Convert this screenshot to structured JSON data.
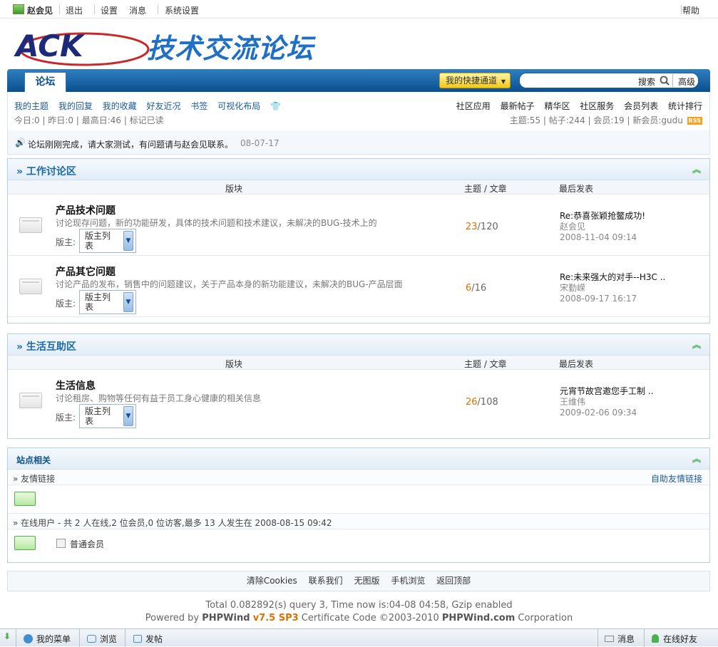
{
  "topbar": {
    "user": "赵会见",
    "logout": "退出",
    "settings": "设置",
    "messages": "消息",
    "system_settings": "系统设置",
    "help": "帮助"
  },
  "header": {
    "logo_text": "ACK",
    "site_title": "技术交流论坛"
  },
  "nav": {
    "tab": "论坛",
    "quick_label": "我的快捷通道",
    "search_label": "搜索",
    "advanced": "高级"
  },
  "subnav": {
    "links": [
      "我的主题",
      "我的回复",
      "我的收藏",
      "好友近况",
      "书签",
      "可视化布局"
    ],
    "right_links": [
      "社区应用",
      "最新帖子",
      "精华区",
      "社区服务",
      "会员列表",
      "统计排行"
    ],
    "stats_left": "今日:0 | 昨日:0 | 最高日:46 | 标记已读",
    "stats_right": "主题:55 | 帖子:244 | 会员:19 | 新会员:gudu",
    "rss": "RSS"
  },
  "notice": {
    "text": "论坛刚刚完成，请大家测试，有问题请与赵会见联系。",
    "date": "08-07-17"
  },
  "columns": {
    "forum": "版块",
    "counts": "主题 / 文章",
    "last": "最后发表"
  },
  "moderator_label": "版主:",
  "moderator_select": "版主列表",
  "sections": [
    {
      "title": "» 工作讨论区",
      "forums": [
        {
          "name": "产品技术问题",
          "desc": "讨论现存问题，新的功能研发，具体的技术问题和技术建议，未解决的BUG-技术上的",
          "topics": "23",
          "posts": "/120",
          "last_title": "Re:恭喜张颖抢鳖成功!",
          "last_author": "赵会见",
          "last_time": "2008-11-04 09:14"
        },
        {
          "name": "产品其它问题",
          "desc": "讨论产品的发布，销售中的问题建议，关于产品本身的新功能建议，未解决的BUG-产品层面",
          "topics": "6",
          "posts": "/16",
          "last_title": "Re:未来强大的对手--H3C ..",
          "last_author": "宋勤嵘",
          "last_time": "2008-09-17 16:17"
        }
      ]
    },
    {
      "title": "» 生活互助区",
      "forums": [
        {
          "name": "生活信息",
          "desc": "讨论租房、购物等任何有益于员工身心健康的相关信息",
          "topics": "26",
          "posts": "/108",
          "last_title": "元宵节故宫邀您手工制 ..",
          "last_author": "王维伟",
          "last_time": "2009-02-06 09:34"
        }
      ]
    }
  ],
  "site": {
    "title": "站点相关",
    "links_label": "» 友情链接",
    "links_action": "自助友情链接",
    "online_label": "» 在线用户  - 共 2 人在线,2 位会员,0 位访客,最多 13 人发生在 2008-08-15 09:42",
    "member_type": "普通会员"
  },
  "footer": {
    "links": [
      "清除Cookies",
      "联系我们",
      "无图版",
      "手机浏览",
      "返回顶部"
    ],
    "line1": "Total 0.082892(s) query 3, Time now is:04-08 04:58, Gzip enabled",
    "line2_pre": "Powered by ",
    "brand": "PHPWind",
    "version": "v7.5 SP3",
    "line2_mid": " Certificate Code ©2003-2010 ",
    "brand2": "PHPWind.com",
    "line2_post": " Corporation"
  },
  "bottombar": {
    "menu": "我的菜单",
    "browse": "浏览",
    "post": "发帖",
    "msg": "消息",
    "friends": "在线好友"
  },
  "colors": {
    "accent": "#1c6aa8",
    "nav": "#0b4f8e",
    "count": "#e07000"
  }
}
